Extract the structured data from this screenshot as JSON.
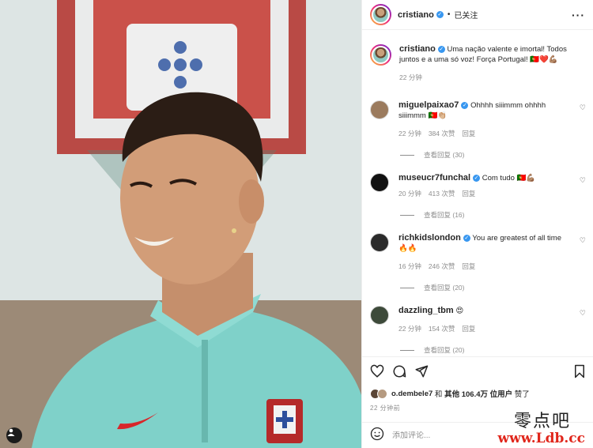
{
  "header": {
    "username": "cristiano",
    "verified_icon": "verified-badge-icon",
    "separator": "•",
    "follow_status": "已关注",
    "more": "···"
  },
  "caption": {
    "username": "cristiano",
    "text": "Uma nação valente e imortal! Todos juntos e a uma só voz! Força Portugal! 🇵🇹❤️💪🏽",
    "time": "22 分钟"
  },
  "comments": [
    {
      "username": "miguelpaixao7",
      "text": "Ohhhh siiimmm ohhhh siiimmm 🇵🇹👏🏼",
      "time": "22 分钟",
      "likes": "384 次赞",
      "reply": "回复",
      "view_replies": "查看回复 (30)",
      "avatar_color": "#9b7b5e"
    },
    {
      "username": "museucr7funchal",
      "text": "Com tudo 🇵🇹💪🏽",
      "time": "20 分钟",
      "likes": "413 次赞",
      "reply": "回复",
      "view_replies": "查看回复 (16)",
      "avatar_color": "#111111"
    },
    {
      "username": "richkidslondon",
      "text": "You are greatest of all time 🔥🔥",
      "time": "16 分钟",
      "likes": "246 次赞",
      "reply": "回复",
      "view_replies": "查看回复 (20)",
      "avatar_color": "#2b2b2b"
    },
    {
      "username": "dazzling_tbm",
      "text": "😍",
      "time": "22 分钟",
      "likes": "154 次赞",
      "reply": "回复",
      "view_replies": "查看回复 (20)",
      "avatar_color": "#3d4a3a"
    }
  ],
  "actions": {
    "like_icon": "heart-icon",
    "comment_icon": "comment-icon",
    "share_icon": "send-icon",
    "save_icon": "bookmark-icon"
  },
  "likes": {
    "first_user": "o.dembele7",
    "and_text": "和",
    "others": "其他 106.4万 位用户",
    "liked": "赞了"
  },
  "post_time": "22 分钟前",
  "comment_input": {
    "placeholder": "添加评论...",
    "emoji_icon": "smile-icon"
  },
  "watermark": {
    "cn": "零点吧",
    "url": "www.Ldb.cc"
  },
  "colors": {
    "verified": "#3897f0",
    "jersey": "#7fd1c9",
    "watermark_url": "#e0261b"
  }
}
